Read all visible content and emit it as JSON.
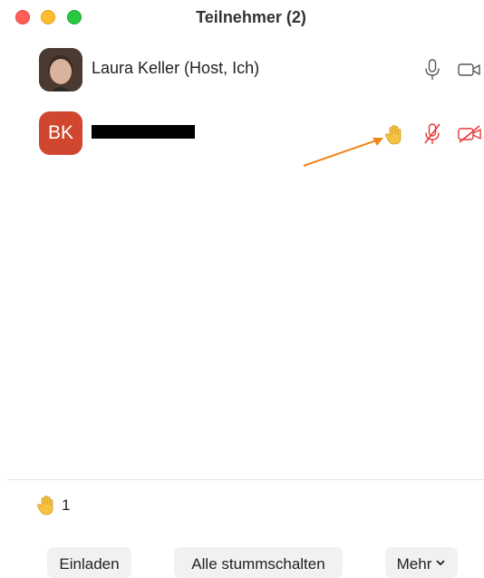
{
  "window": {
    "title": "Teilnehmer (2)"
  },
  "participants": [
    {
      "name": "Laura Keller (Host, Ich)"
    },
    {
      "initials": "BK"
    }
  ],
  "raised_hands": {
    "count": "1"
  },
  "buttons": {
    "invite": "Einladen",
    "mute_all": "Alle stummschalten",
    "more": "Mehr"
  },
  "colors": {
    "muted_red": "#e8373a",
    "avatar_red": "#d0462f",
    "hand_yellow": "#f5c242",
    "arrow_orange": "#f0871a"
  },
  "icons": [
    "microphone-icon",
    "video-camera-icon",
    "raised-hand-icon",
    "microphone-muted-icon",
    "video-camera-off-icon",
    "chevron-down-icon"
  ]
}
